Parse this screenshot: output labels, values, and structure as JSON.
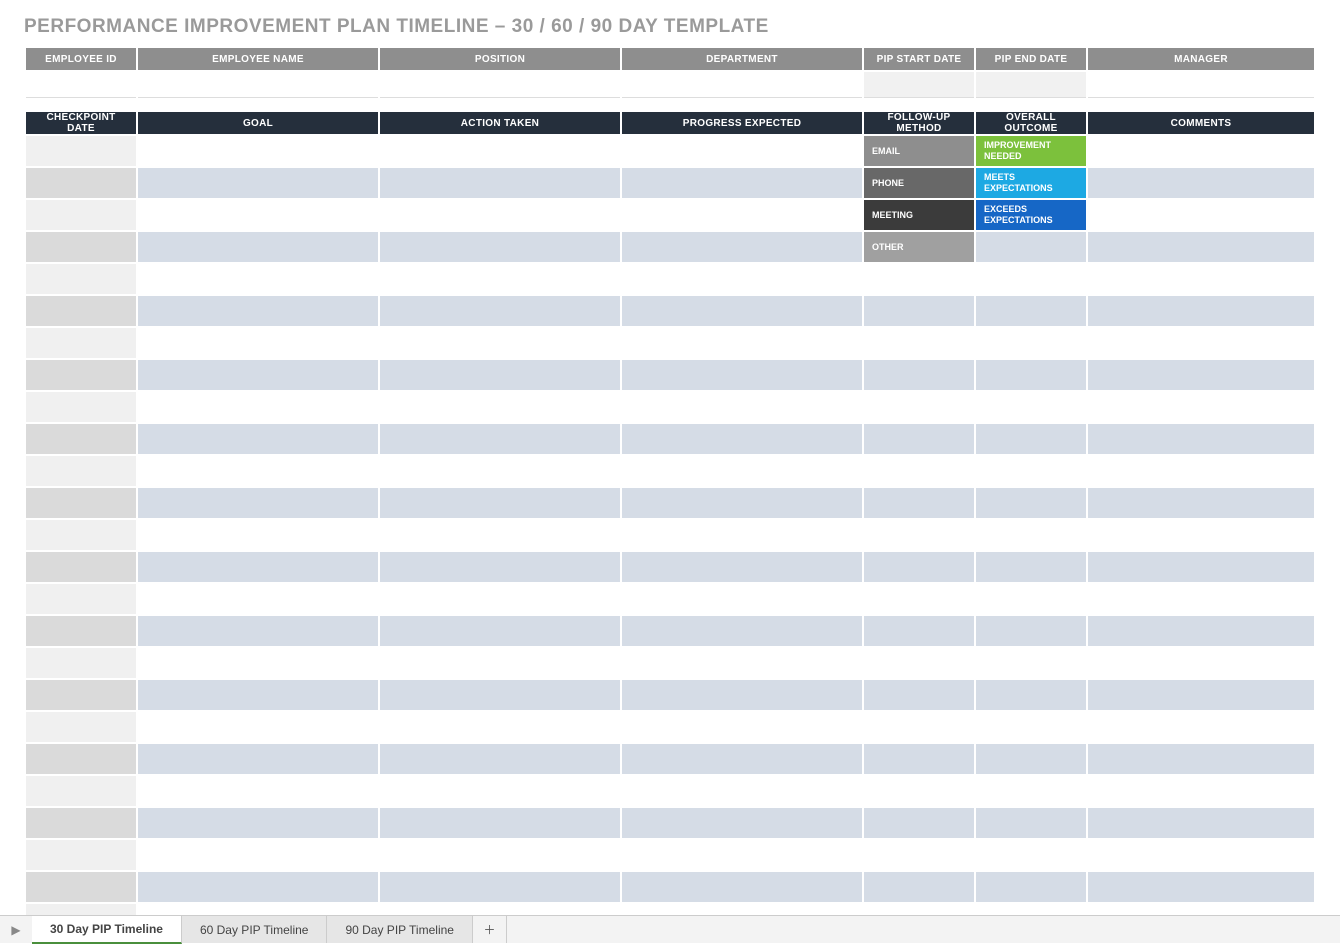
{
  "title": "PERFORMANCE IMPROVEMENT PLAN TIMELINE  –  30 / 60 / 90 DAY TEMPLATE",
  "info_headers": {
    "employee_id": "EMPLOYEE ID",
    "employee_name": "EMPLOYEE NAME",
    "position": "POSITION",
    "department": "DEPARTMENT",
    "pip_start": "PIP START DATE",
    "pip_end": "PIP END DATE",
    "manager": "MANAGER"
  },
  "info_values": {
    "employee_id": "",
    "employee_name": "",
    "position": "",
    "department": "",
    "pip_start": "",
    "pip_end": "",
    "manager": ""
  },
  "main_headers": {
    "checkpoint": "CHECKPOINT DATE",
    "goal": "GOAL",
    "action": "ACTION TAKEN",
    "progress": "PROGRESS EXPECTED",
    "follow": "FOLLOW-UP METHOD",
    "outcome": "OVERALL OUTCOME",
    "comments": "COMMENTS"
  },
  "followup_options": {
    "email": "EMAIL",
    "phone": "PHONE",
    "meeting": "MEETING",
    "other": "OTHER"
  },
  "outcome_options": {
    "improvement": "IMPROVEMENT NEEDED",
    "meets": "MEETS EXPECTATIONS",
    "exceeds": "EXCEEDS EXPECTATIONS"
  },
  "tabs": {
    "t30": "30 Day PIP Timeline",
    "t60": "60 Day PIP Timeline",
    "t90": "90 Day PIP Timeline"
  },
  "row_count": 25
}
